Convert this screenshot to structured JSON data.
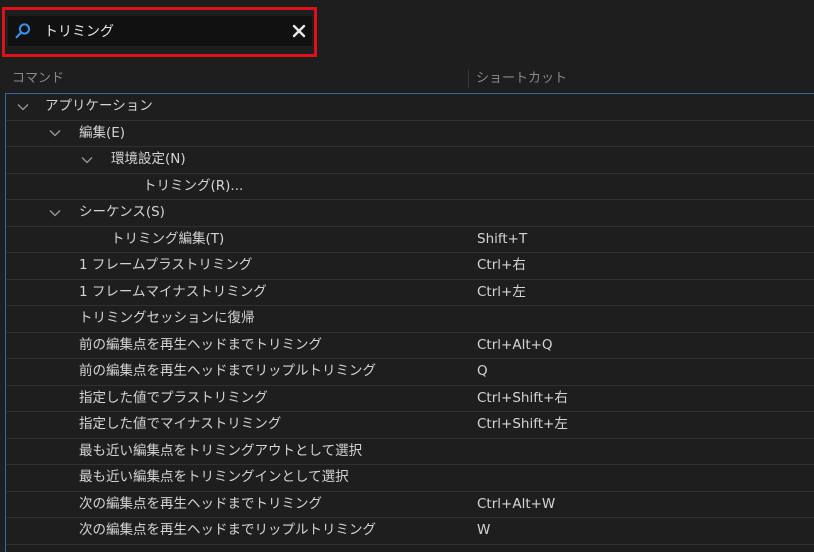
{
  "search": {
    "value": "トリミング"
  },
  "columns": {
    "command": "コマンド",
    "shortcut": "ショートカット"
  },
  "rows": [
    {
      "label": "アプリケーション",
      "shortcut": "",
      "level": 0,
      "expanded": true
    },
    {
      "label": "編集(E)",
      "shortcut": "",
      "level": 1,
      "expanded": true
    },
    {
      "label": "環境設定(N)",
      "shortcut": "",
      "level": 2,
      "expanded": true
    },
    {
      "label": "トリミング(R)...",
      "shortcut": "",
      "level": 3,
      "expanded": null
    },
    {
      "label": "シーケンス(S)",
      "shortcut": "",
      "level": 1,
      "expanded": true
    },
    {
      "label": "トリミング編集(T)",
      "shortcut": "Shift+T",
      "level": 2,
      "expanded": null
    },
    {
      "label": "1 フレームプラストリミング",
      "shortcut": "Ctrl+右",
      "level": 1,
      "expanded": null
    },
    {
      "label": "1 フレームマイナストリミング",
      "shortcut": "Ctrl+左",
      "level": 1,
      "expanded": null
    },
    {
      "label": "トリミングセッションに復帰",
      "shortcut": "",
      "level": 1,
      "expanded": null
    },
    {
      "label": "前の編集点を再生ヘッドまでトリミング",
      "shortcut": "Ctrl+Alt+Q",
      "level": 1,
      "expanded": null
    },
    {
      "label": "前の編集点を再生ヘッドまでリップルトリミング",
      "shortcut": "Q",
      "level": 1,
      "expanded": null
    },
    {
      "label": "指定した値でプラストリミング",
      "shortcut": "Ctrl+Shift+右",
      "level": 1,
      "expanded": null
    },
    {
      "label": "指定した値でマイナストリミング",
      "shortcut": "Ctrl+Shift+左",
      "level": 1,
      "expanded": null
    },
    {
      "label": "最も近い編集点をトリミングアウトとして選択",
      "shortcut": "",
      "level": 1,
      "expanded": null
    },
    {
      "label": "最も近い編集点をトリミングインとして選択",
      "shortcut": "",
      "level": 1,
      "expanded": null
    },
    {
      "label": "次の編集点を再生ヘッドまでトリミング",
      "shortcut": "Ctrl+Alt+W",
      "level": 1,
      "expanded": null
    },
    {
      "label": "次の編集点を再生ヘッドまでリップルトリミング",
      "shortcut": "W",
      "level": 1,
      "expanded": null
    }
  ],
  "colors": {
    "background": "#1e1e1e",
    "highlight": "#e0101a",
    "accent": "#2c6aa8",
    "search_icon": "#3a8ee6"
  },
  "icons": {
    "search": "search-icon",
    "clear": "close-icon",
    "expand": "chevron-down-icon"
  }
}
